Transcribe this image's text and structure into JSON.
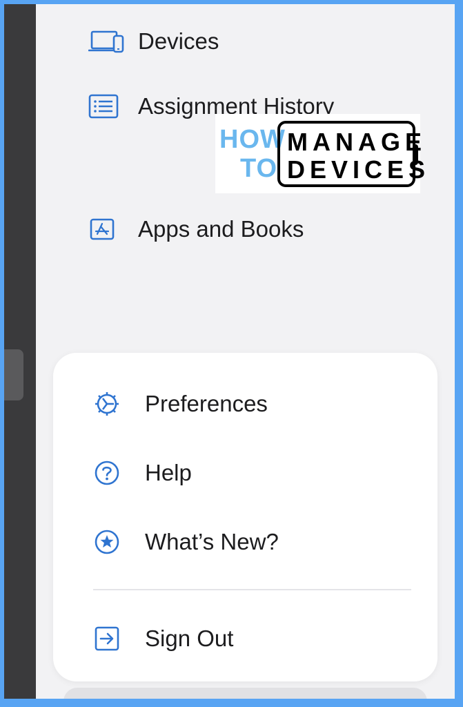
{
  "nav": {
    "items": [
      {
        "label": "Devices",
        "icon": "laptop-phone-icon"
      },
      {
        "label": "Assignment History",
        "icon": "list-icon"
      },
      {
        "label": "Apps and Books",
        "icon": "app-store-icon"
      }
    ]
  },
  "watermark": {
    "line1a": "HOW",
    "line1b": "MANAGE",
    "line2a": "TO",
    "line2b": "DEVICES"
  },
  "menu": {
    "items": [
      {
        "label": "Preferences",
        "icon": "gear-icon"
      },
      {
        "label": "Help",
        "icon": "question-circle-icon"
      },
      {
        "label": "What’s New?",
        "icon": "star-circle-icon"
      },
      {
        "label": "Sign Out",
        "icon": "sign-out-icon"
      }
    ]
  },
  "colors": {
    "accent": "#2f74d0",
    "frame": "#58a4f3",
    "background": "#f2f2f4",
    "watermark_blue": "#6ab7ee"
  }
}
